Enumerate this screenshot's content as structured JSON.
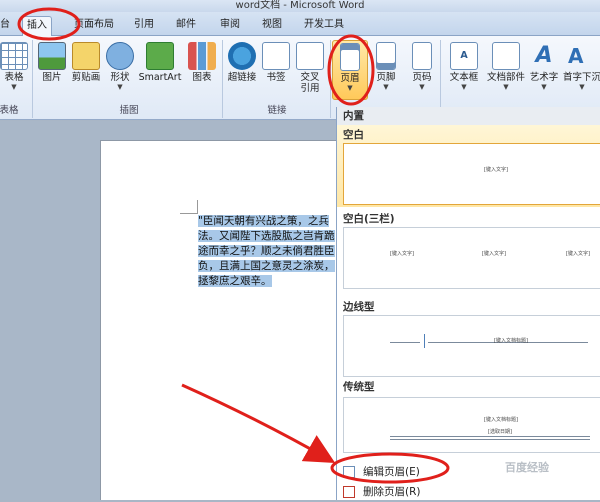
{
  "window": {
    "title": "word文档 - Microsoft Word"
  },
  "tabs": [
    "台",
    "插入",
    "页面布局",
    "引用",
    "邮件",
    "审阅",
    "视图",
    "开发工具"
  ],
  "ribbon": {
    "buttons": [
      {
        "label": "表格",
        "icon": "table-icon"
      },
      {
        "label": "图片",
        "icon": "picture-icon"
      },
      {
        "label": "剪贴画",
        "icon": "clipart-icon"
      },
      {
        "label": "形状",
        "icon": "shapes-icon"
      },
      {
        "label": "SmartArt",
        "icon": "smartart-icon"
      },
      {
        "label": "图表",
        "icon": "chart-icon"
      },
      {
        "label": "超链接",
        "icon": "hyperlink-icon"
      },
      {
        "label": "书签",
        "icon": "bookmark-icon"
      },
      {
        "label": "交叉",
        "label2": "引用",
        "icon": "cross-reference-icon"
      },
      {
        "label": "页眉",
        "icon": "header-icon"
      },
      {
        "label": "页脚",
        "icon": "footer-icon"
      },
      {
        "label": "页码",
        "icon": "page-number-icon"
      },
      {
        "label": "文本框",
        "icon": "textbox-icon"
      },
      {
        "label": "文档部件",
        "icon": "quick-parts-icon"
      },
      {
        "label": "艺术字",
        "icon": "wordart-icon"
      },
      {
        "label": "首字下沉",
        "icon": "dropcap-icon"
      }
    ],
    "groups": [
      "表格",
      "插图",
      "链接"
    ]
  },
  "document": {
    "text": "\"臣闻天朝有兴战之策，之兵法。又闻陛下选股肱之岂肯跪途而幸之乎？顺之未倘君胜臣负，且满上国之意灵之涂炭，拯黎庶之艰辛。"
  },
  "gallery": {
    "builtin": "内置",
    "blank": {
      "title": "空白",
      "placeholder": "[键入文字]"
    },
    "blank3": {
      "title": "空白(三栏)",
      "placeholder": "[键入文字]"
    },
    "border": {
      "title": "边线型",
      "placeholder": "[键入文档标题]"
    },
    "traditional": {
      "title": "传统型",
      "placeholder1": "[键入文档标题]",
      "placeholder2": "[选取日期]"
    },
    "edit_header": "编辑页眉(E)",
    "remove_header": "删除页眉(R)"
  },
  "watermark": "百度经验"
}
